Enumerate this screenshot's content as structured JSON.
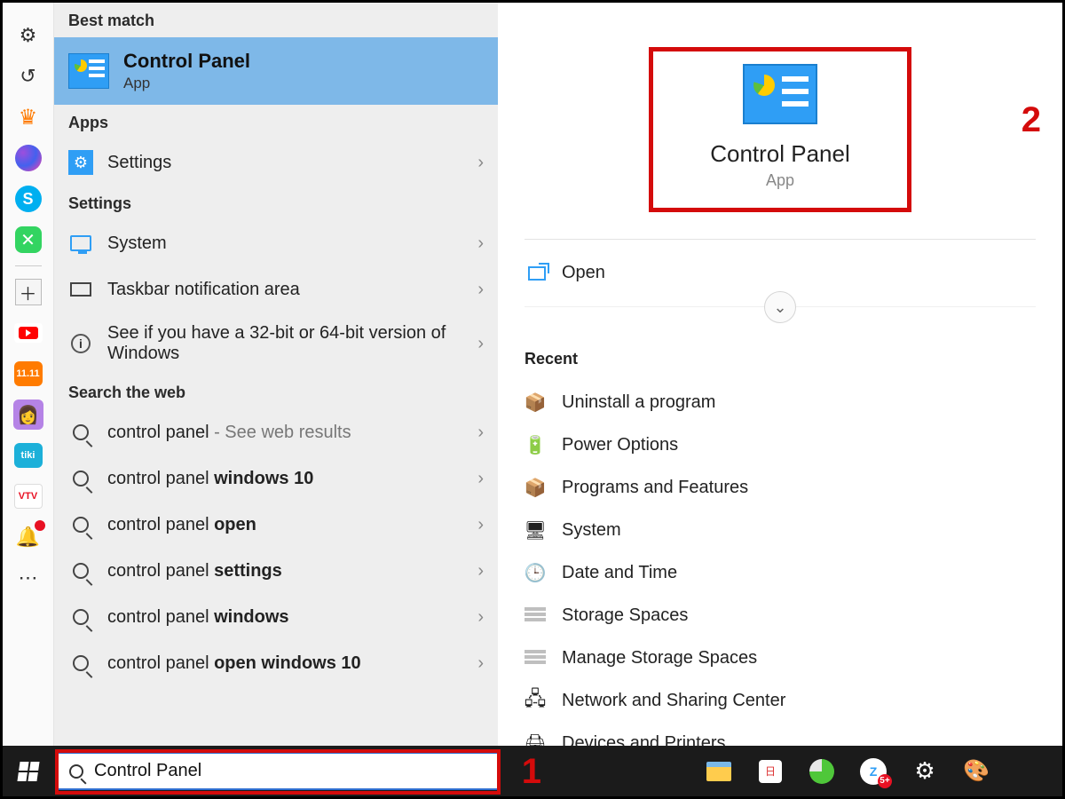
{
  "searchPanel": {
    "bestMatchHeader": "Best match",
    "bestMatch": {
      "title": "Control Panel",
      "subtitle": "App"
    },
    "appsHeader": "Apps",
    "appsItems": [
      {
        "label": "Settings"
      }
    ],
    "settingsHeader": "Settings",
    "settingsItems": [
      {
        "label": "System"
      },
      {
        "label": "Taskbar notification area"
      },
      {
        "label": "See if you have a 32-bit or 64-bit version of Windows"
      }
    ],
    "webHeader": "Search the web",
    "webItems": [
      {
        "prefix": "control panel",
        "suffix": " - See web results",
        "bold": ""
      },
      {
        "prefix": "control panel ",
        "bold": "windows 10"
      },
      {
        "prefix": "control panel ",
        "bold": "open"
      },
      {
        "prefix": "control panel ",
        "bold": "settings"
      },
      {
        "prefix": "control panel ",
        "bold": "windows"
      },
      {
        "prefix": "control panel ",
        "bold": "open windows 10"
      }
    ]
  },
  "detail": {
    "title": "Control Panel",
    "subtitle": "App",
    "openLabel": "Open",
    "recentHeader": "Recent",
    "recent": [
      "Uninstall a program",
      "Power Options",
      "Programs and Features",
      "System",
      "Date and Time",
      "Storage Spaces",
      "Manage Storage Spaces",
      "Network and Sharing Center",
      "Devices and Printers"
    ]
  },
  "searchBox": {
    "value": "Control Panel"
  },
  "callouts": {
    "one": "1",
    "two": "2"
  },
  "rail": {
    "orange": "11.11",
    "teal": "tiki",
    "vtv": "VTV"
  },
  "taskbar": {
    "zaloBadge": "5+"
  }
}
